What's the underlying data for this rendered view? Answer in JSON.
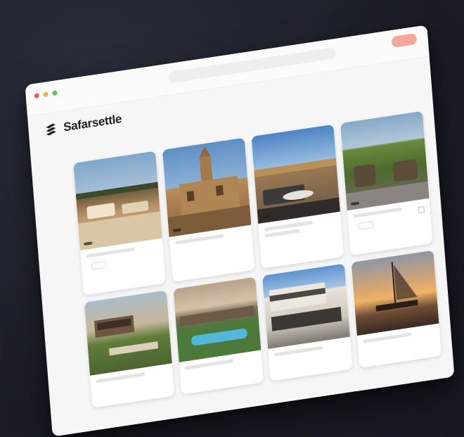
{
  "window": {
    "traffic_lights": [
      "#e65f57",
      "#eab24b",
      "#5ec34e"
    ],
    "url_placeholder": "",
    "language_select": "",
    "signin_label": ""
  },
  "brand": {
    "name": "Safarsettle",
    "logo_icon": "layered-stripes-icon"
  },
  "header_links": [
    "",
    ""
  ],
  "tabs": [
    "",
    "",
    "",
    "",
    ""
  ],
  "listings": [
    {
      "badge": "",
      "title": "",
      "price": ""
    },
    {
      "badge": "",
      "title": "",
      "price": ""
    },
    {
      "badge": "",
      "title": "",
      "price": ""
    },
    {
      "badge": "",
      "title": "",
      "price": ""
    },
    {
      "badge": "",
      "title": "",
      "price": ""
    },
    {
      "badge": "",
      "title": "",
      "price": ""
    },
    {
      "badge": "",
      "title": "",
      "price": ""
    },
    {
      "badge": "",
      "title": "",
      "price": ""
    }
  ],
  "colors": {
    "accent": "#f3a898",
    "background": "#1c1f29"
  }
}
